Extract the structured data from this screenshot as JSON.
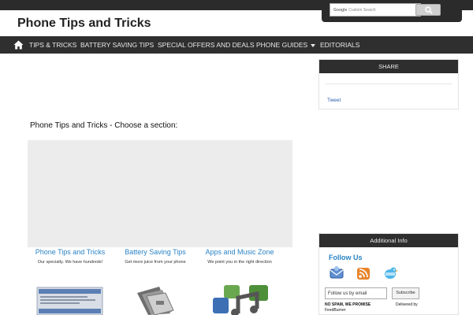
{
  "site": {
    "title": "Phone Tips and Tricks"
  },
  "search": {
    "logo_text": "Google",
    "placeholder": "Custom Search"
  },
  "nav": {
    "home_icon": "home-icon",
    "items": [
      {
        "label": "TIPS & TRICKS"
      },
      {
        "label": "BATTERY SAVING TIPS"
      },
      {
        "label": "SPECIAL OFFERS AND DEALS"
      },
      {
        "label": "PHONE GUIDES",
        "has_dropdown": true
      },
      {
        "label": "EDITORIALS"
      }
    ]
  },
  "main": {
    "heading": "Phone Tips and Tricks - Choose a section:",
    "features": [
      {
        "title": "Phone Tips and Tricks",
        "subtitle": "Our specialty. We have hundreds!"
      },
      {
        "title": "Battery Saving Tips",
        "subtitle": "Get more juice from your phone"
      },
      {
        "title": "Apps and Music Zone",
        "subtitle": "We point you in the right direction"
      }
    ]
  },
  "sidebar": {
    "share": {
      "heading": "SHARE",
      "tweet_label": "Tweet"
    },
    "info": {
      "heading": "Additional Info",
      "follow_title": "Follow Us",
      "email_placeholder": "Follow us by email",
      "subscribe_label": "Subscribe",
      "nospam": "NO SPAM, WE PROMISE",
      "delivered_by": "Delivered by",
      "feedburner": "FeedBurner"
    }
  },
  "colors": {
    "nav_bg": "#2f2f2f",
    "link_blue": "#2a83c5",
    "panel_gray": "#ececec"
  }
}
